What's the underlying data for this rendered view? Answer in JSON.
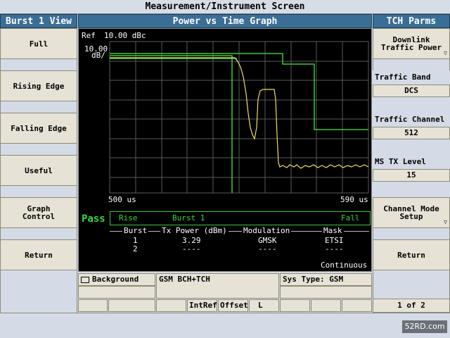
{
  "title": "Measurement/Instrument Screen",
  "left_panel": {
    "header": "Burst 1 View",
    "buttons": [
      "Full",
      "Rising Edge",
      "Falling Edge",
      "Useful",
      "Graph Control",
      "Return"
    ]
  },
  "center": {
    "header": "Power vs Time Graph",
    "ref_label": "Ref",
    "ref_value": "10.00 dBc",
    "scale_value": "10.00",
    "scale_unit": "dB/",
    "x_start": "500 us",
    "x_end": "590 us",
    "pass_text": "Pass",
    "rise_label": "Rise",
    "burst_label": "Burst 1",
    "fall_label": "Fall",
    "table": {
      "headers": [
        "Burst",
        "Tx Power (dBm)",
        "Modulation",
        "Mask"
      ],
      "rows": [
        [
          "1",
          "3.29",
          "GMSK",
          "ETSI"
        ],
        [
          "2",
          "----",
          "----",
          "----"
        ]
      ]
    },
    "continuous": "Continuous"
  },
  "right_panel": {
    "header": "TCH Parms",
    "downlink_label": "Downlink Traffic Power",
    "traffic_band_label": "Traffic Band",
    "traffic_band_value": "DCS",
    "traffic_channel_label": "Traffic Channel",
    "traffic_channel_value": "512",
    "ms_tx_label": "MS TX Level",
    "ms_tx_value": "15",
    "channel_mode_label": "Channel Mode Setup",
    "return_label": "Return",
    "page_indicator": "1 of 2"
  },
  "status": {
    "background": "Background",
    "gsm": "GSM BCH+TCH",
    "sys_type": "Sys Type: GSM",
    "intref": "IntRef",
    "offset": "Offset",
    "l": "L"
  },
  "watermark": "52RD.com",
  "colors": {
    "header_blue": "#3b6e96",
    "trace_yellow": "#f0e060",
    "mask_green": "#3cc83c",
    "pass_green": "#35d835"
  }
}
